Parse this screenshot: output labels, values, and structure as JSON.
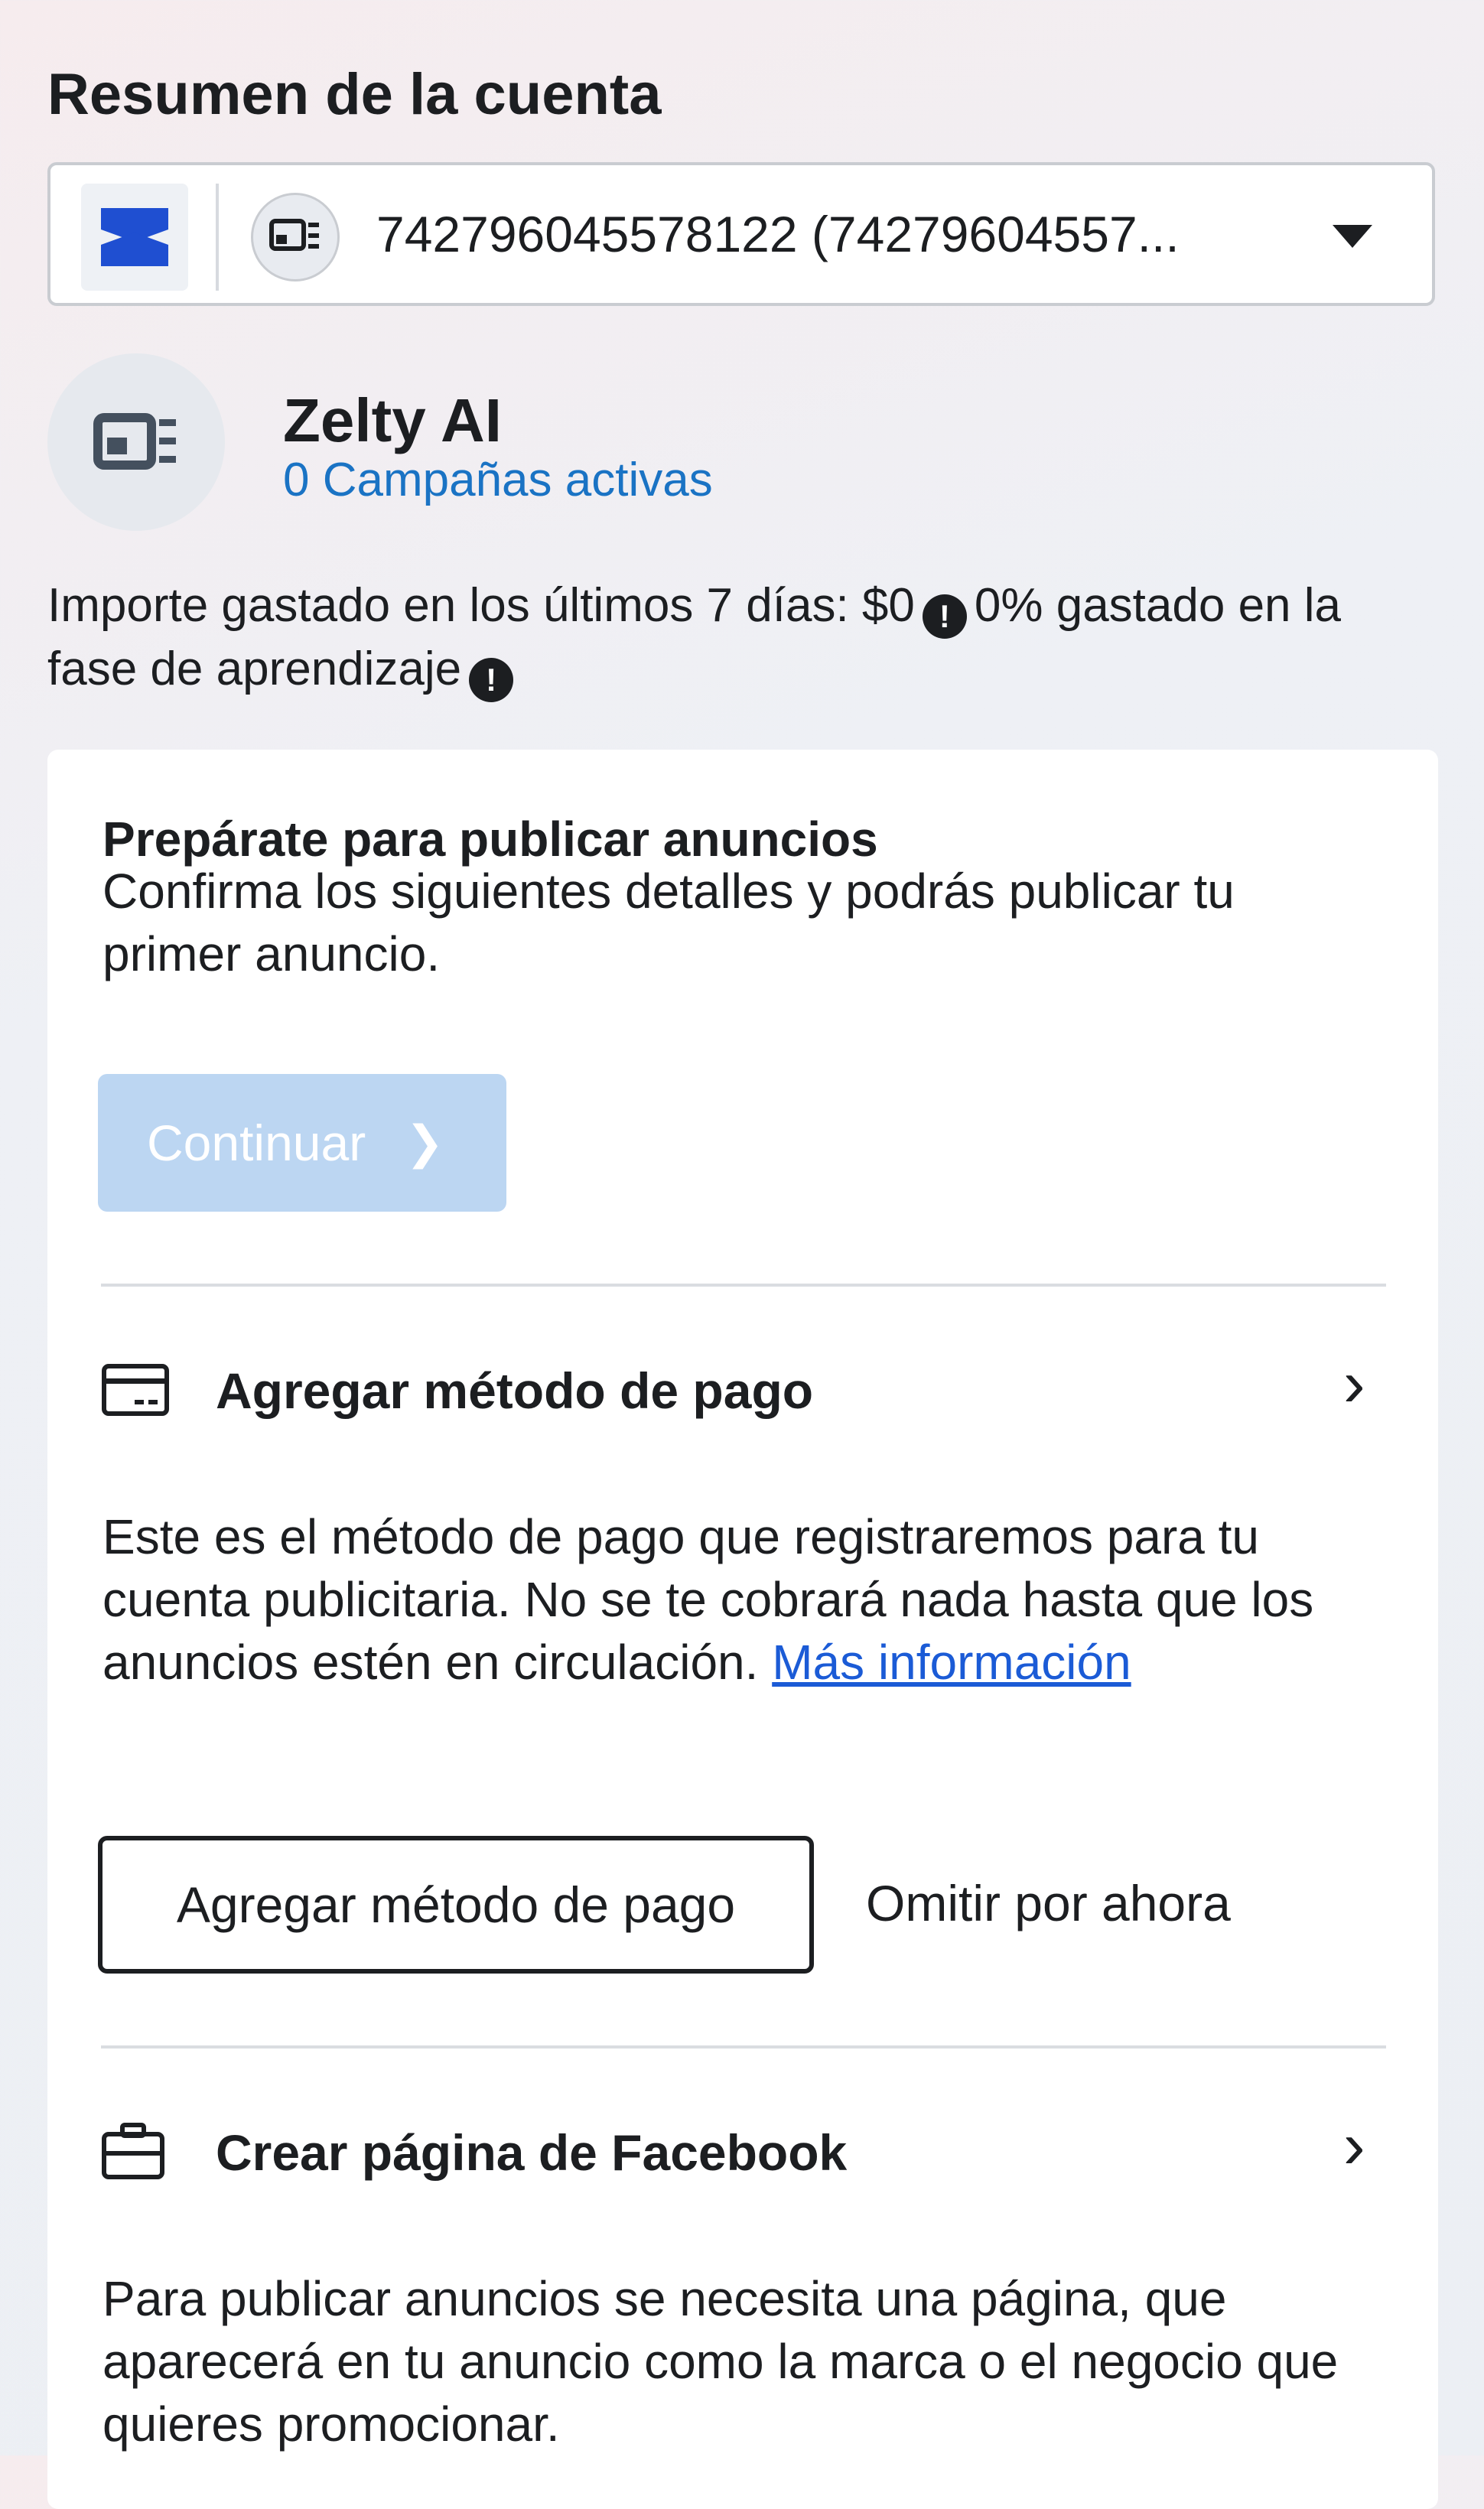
{
  "header": {
    "title": "Resumen de la cuenta"
  },
  "account_selector": {
    "value": "742796045578122 (74279604557..."
  },
  "account": {
    "name": "Zelty AI",
    "active_campaigns": "0 Campañas activas"
  },
  "spend": {
    "text_before": "Importe gastado en los últimos 7 días: $0",
    "text_middle": "0% gastado en la fase de aprendizaje",
    "info_glyph": "!"
  },
  "setup_card": {
    "title": "Prepárate para publicar anuncios",
    "subtitle": "Confirma los siguientes detalles y podrás publicar tu primer anuncio.",
    "continue_label": "Continuar",
    "payment": {
      "title": "Agregar método de pago",
      "description": "Este es el método de pago que registraremos para tu cuenta publicitaria. No se te cobrará nada hasta que los anuncios estén en circulación.",
      "link_label": "Más información",
      "add_button": "Agregar método de pago",
      "skip_button": "Omitir por ahora"
    },
    "facebook_page": {
      "title": "Crear página de Facebook",
      "description": "Para publicar anuncios se necesita una página, que aparecerá en tu anuncio como la marca o el negocio que quieres promocionar."
    }
  },
  "colors": {
    "link": "#1b5bd6",
    "campaigns": "#1a73c4",
    "disabled_button": "#bcd6f2",
    "brand": "#1f4fd1"
  },
  "icons": [
    "brand-logo-icon",
    "ad-account-icon",
    "dropdown-caret-icon",
    "info-icon",
    "chevron-right-icon",
    "credit-card-icon",
    "briefcase-icon"
  ]
}
